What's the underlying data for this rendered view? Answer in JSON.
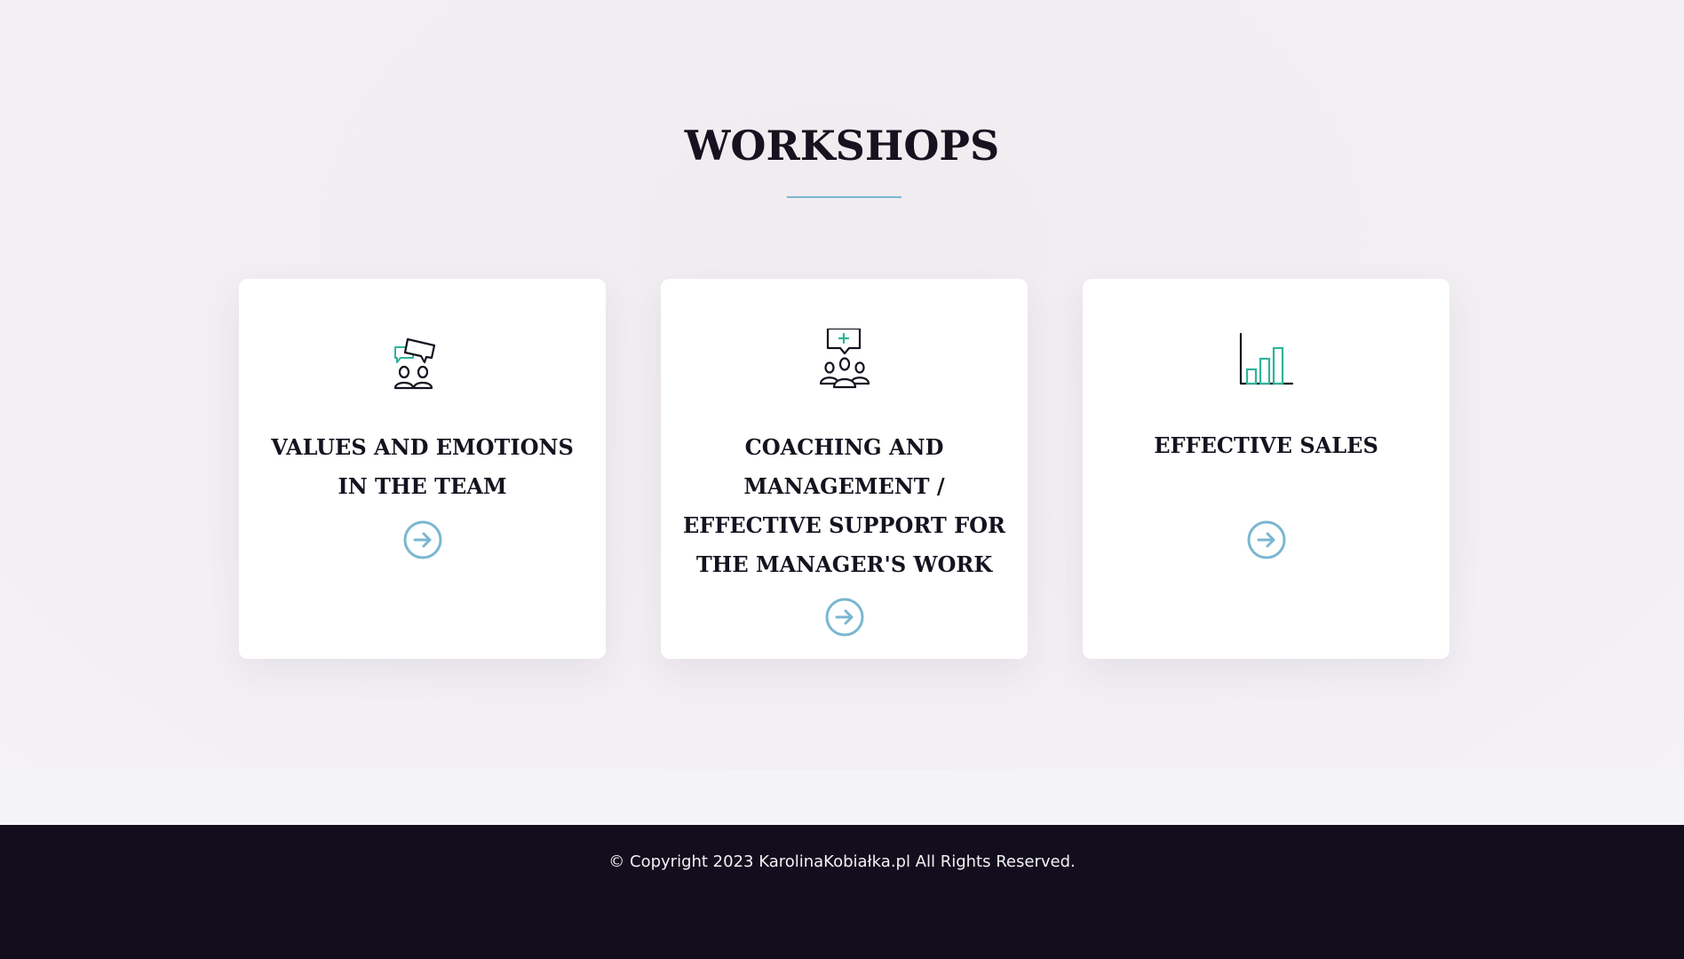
{
  "section": {
    "title": "WORKSHOPS"
  },
  "cards": [
    {
      "title": "VALUES AND EMOTIONS IN THE TEAM",
      "icon": "team-discussion-icon",
      "link_icon": "arrow-right-circle-icon"
    },
    {
      "title": "COACHING AND MANAGEMENT / EFFECTIVE SUPPORT FOR THE MANAGER'S WORK",
      "icon": "group-meeting-icon",
      "link_icon": "arrow-right-circle-icon"
    },
    {
      "title": "EFFECTIVE SALES",
      "icon": "bar-chart-icon",
      "link_icon": "arrow-right-circle-icon"
    }
  ],
  "footer": {
    "copyright": "© Copyright 2023 KarolinaKobiałka.pl All Rights Reserved."
  },
  "colors": {
    "accent": "#7ab7d1",
    "icon_green": "#2fb39a",
    "dark": "#16121f",
    "footer_bg": "#130e1d"
  }
}
